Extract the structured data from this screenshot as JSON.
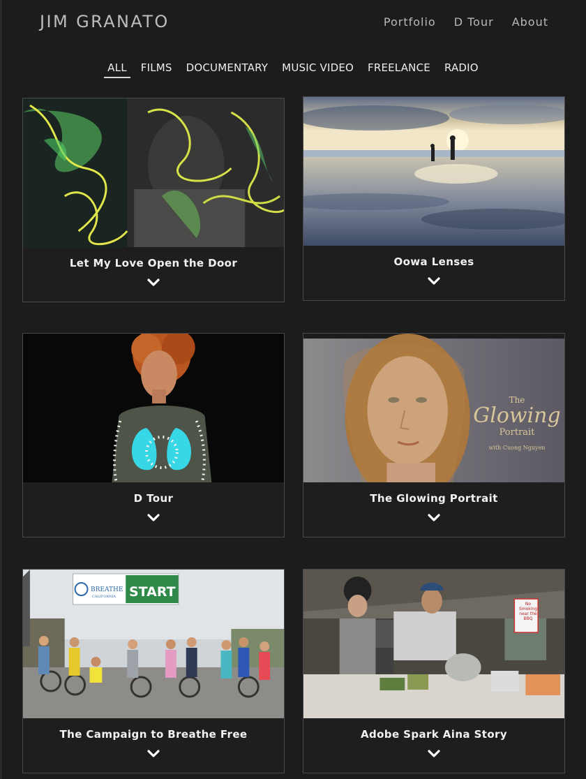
{
  "header": {
    "brand": "JIM GRANATO",
    "nav": [
      "Portfolio",
      "D Tour",
      "About"
    ]
  },
  "filters": {
    "items": [
      "ALL",
      "FILMS",
      "DOCUMENTARY",
      "MUSIC VIDEO",
      "FREELANCE",
      "RADIO"
    ],
    "active": "ALL"
  },
  "cards": [
    {
      "title": "Let My Love Open the Door",
      "thumb": "neon-portrait-thumbnail"
    },
    {
      "title": "Oowa Lenses",
      "thumb": "beach-sunset-thumbnail"
    },
    {
      "title": "D Tour",
      "thumb": "lungs-shirt-thumbnail"
    },
    {
      "title": "The Glowing Portrait",
      "thumb": "painted-portrait-thumbnail"
    },
    {
      "title": "The Campaign to Breathe Free",
      "thumb": "cyclists-start-line-thumbnail"
    },
    {
      "title": "Adobe Spark Aina Story",
      "thumb": "chefs-kitchen-thumbnail"
    }
  ],
  "thumb_text": {
    "glowing_the": "The",
    "glowing_script": "Glowing",
    "glowing_portrait": "Portrait",
    "glowing_with": "with Cuong Nguyen",
    "banner_org": "BREATHE",
    "banner_sub": "CALIFORNIA",
    "banner_start": "START",
    "sign_text": "No Smoking near the BBQ"
  },
  "colors": {
    "background": "#1c1c1c",
    "text": "#f2f2f2",
    "nav": "#b9b9b9"
  }
}
